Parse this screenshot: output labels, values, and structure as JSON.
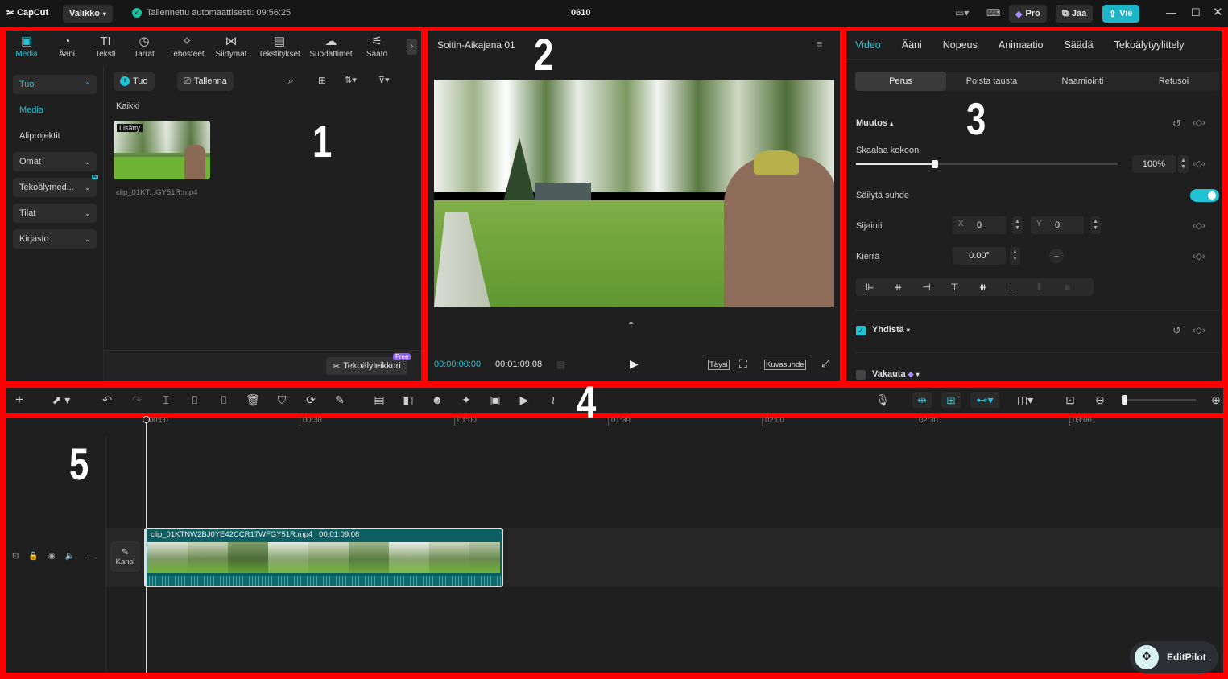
{
  "app": {
    "logo": "CapCut",
    "menu_label": "Valikko",
    "autosave": "Tallennettu automaattisesti: 09:56:25",
    "project_title": "0610",
    "pro_label": "Pro",
    "share_label": "Jaa",
    "export_label": "Vie",
    "colors": {
      "accent": "#1fc3d3",
      "border": "#ff0000",
      "export": "#1fb5c9"
    }
  },
  "annotations": [
    "1",
    "2",
    "3",
    "4",
    "5"
  ],
  "media_toolbar": [
    {
      "label": "Media",
      "icon": "media-icon"
    },
    {
      "label": "Ääni",
      "icon": "audio-icon"
    },
    {
      "label": "Teksti",
      "icon": "text-icon"
    },
    {
      "label": "Tarrat",
      "icon": "sticker-icon"
    },
    {
      "label": "Tehosteet",
      "icon": "effects-icon"
    },
    {
      "label": "Siirtymät",
      "icon": "transition-icon"
    },
    {
      "label": "Tekstitykset",
      "icon": "captions-icon"
    },
    {
      "label": "Suodattimet",
      "icon": "filters-icon"
    },
    {
      "label": "Säätö",
      "icon": "adjust-icon"
    }
  ],
  "sidebar": {
    "items": [
      {
        "label": "Tuo"
      },
      {
        "label": "Media"
      },
      {
        "label": "Aliprojektit"
      },
      {
        "label": "Omat"
      },
      {
        "label": "Tekoälymed..."
      },
      {
        "label": "Tilat"
      },
      {
        "label": "Kirjasto"
      }
    ],
    "ai_badge": "AI"
  },
  "media": {
    "import_label": "Tuo",
    "record_label": "Tallenna",
    "filter_all": "Kaikki",
    "clip_badge": "Lisätty",
    "clip_name": "clip_01KT...GY51R.mp4",
    "ai_cut_label": "Tekoälyleikkuri",
    "free_badge": "Free"
  },
  "player": {
    "title": "Soitin-Aikajana 01",
    "current_time": "00:00:00:00",
    "total_time": "00:01:09:08",
    "full_label": "Täysi",
    "ratio_label": "Kuvasuhde"
  },
  "inspector": {
    "tabs": [
      "Video",
      "Ääni",
      "Nopeus",
      "Animaatio",
      "Säädä",
      "Tekoälytyylittely"
    ],
    "subtabs": [
      "Perus",
      "Poista tausta",
      "Naamiointi",
      "Retusoi"
    ],
    "transform_label": "Muutos",
    "scale_label": "Skaalaa kokoon",
    "scale_value": "100%",
    "scale_fraction": 0.3,
    "keep_ratio_label": "Säilytä suhde",
    "position_label": "Sijainti",
    "x_label": "X",
    "x_value": "0",
    "y_label": "Y",
    "y_value": "0",
    "rotate_label": "Kierrä",
    "rotate_value": "0.00°",
    "blend_label": "Yhdistä",
    "stabilize_label": "Vakauta"
  },
  "timeline": {
    "ticks": [
      "00:00",
      "00:30",
      "01:00",
      "01:30",
      "02:00",
      "02:30",
      "03:00"
    ],
    "cover_label": "Kansi",
    "clip_name": "clip_01KTNW2BJ0YE42CCR17WFGY51R.mp4",
    "clip_duration": "00:01:09:08",
    "editpilot_label": "EditPilot"
  }
}
